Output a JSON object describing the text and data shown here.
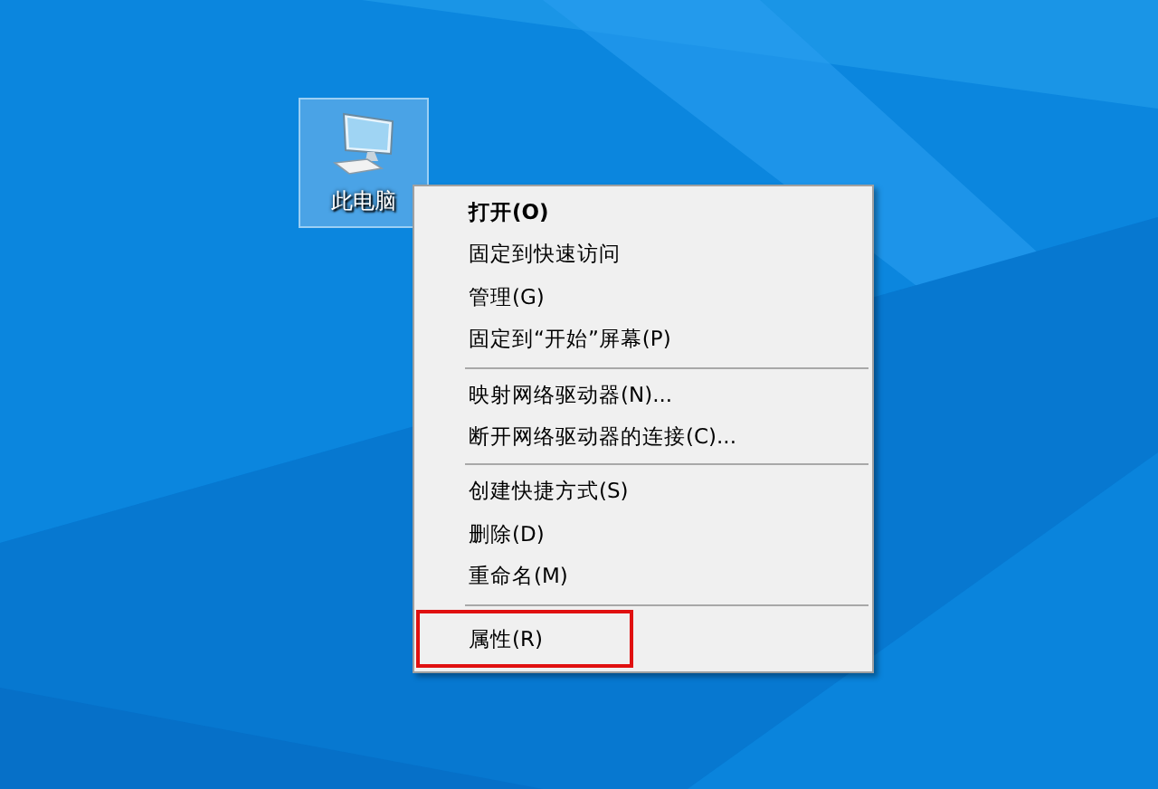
{
  "desktop_icons": [
    {
      "label": "此电脑",
      "selected": true
    }
  ],
  "context_menu": {
    "groups": [
      {
        "items": [
          {
            "label": "打开(O)",
            "default": true,
            "highlighted": false
          },
          {
            "label": "固定到快速访问",
            "default": false,
            "highlighted": false
          },
          {
            "label": "管理(G)",
            "default": false,
            "highlighted": false
          },
          {
            "label": "固定到“开始”屏幕(P)",
            "default": false,
            "highlighted": false
          }
        ]
      },
      {
        "items": [
          {
            "label": "映射网络驱动器(N)...",
            "default": false,
            "highlighted": false
          },
          {
            "label": "断开网络驱动器的连接(C)...",
            "default": false,
            "highlighted": false
          }
        ]
      },
      {
        "items": [
          {
            "label": "创建快捷方式(S)",
            "default": false,
            "highlighted": false
          },
          {
            "label": "删除(D)",
            "default": false,
            "highlighted": false
          },
          {
            "label": "重命名(M)",
            "default": false,
            "highlighted": false
          }
        ]
      },
      {
        "items": [
          {
            "label": "属性(R)",
            "default": false,
            "highlighted": true
          }
        ]
      }
    ]
  }
}
